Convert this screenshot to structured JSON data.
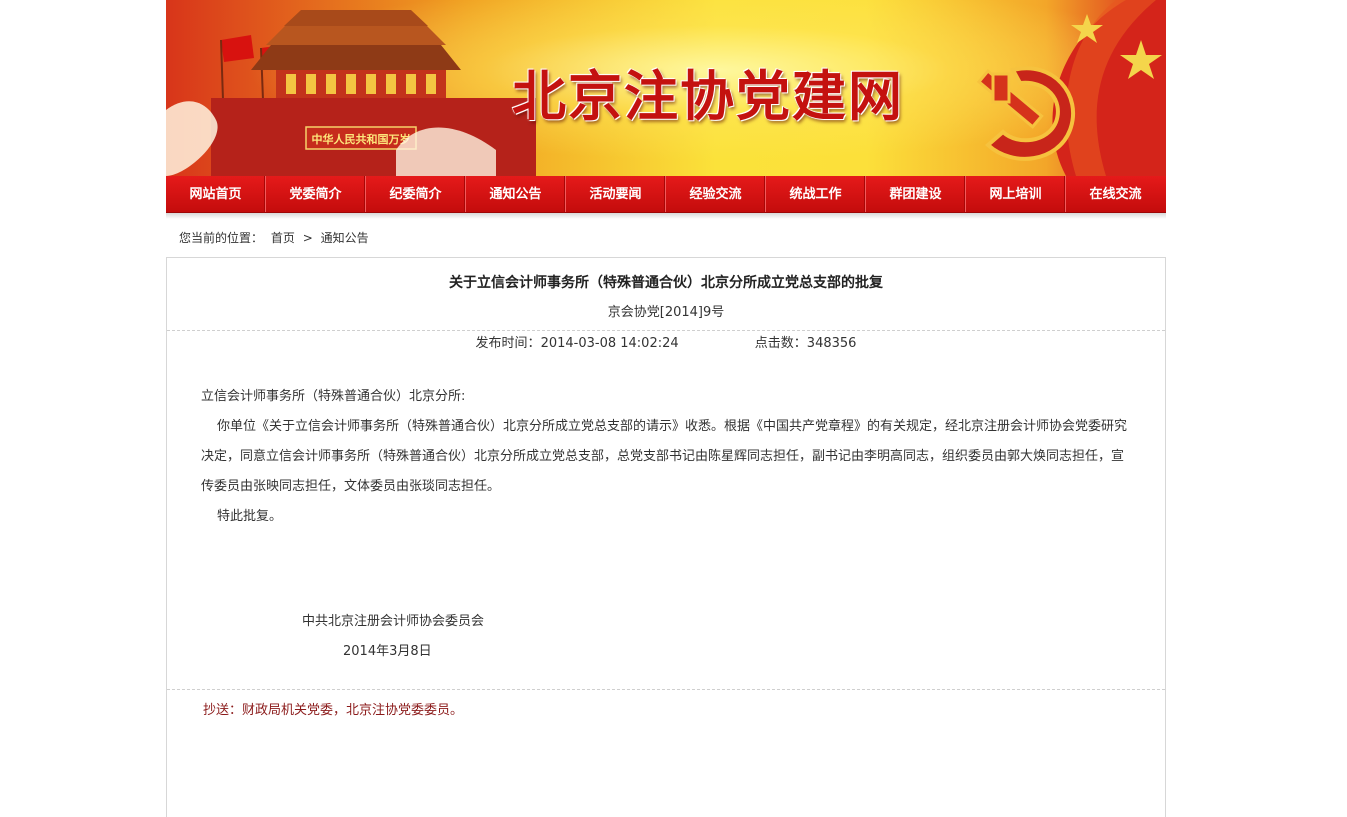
{
  "header": {
    "site_title": "北京注协党建网"
  },
  "nav": {
    "items": [
      "网站首页",
      "党委简介",
      "纪委简介",
      "通知公告",
      "活动要闻",
      "经验交流",
      "统战工作",
      "群团建设",
      "网上培训",
      "在线交流"
    ]
  },
  "breadcrumb": {
    "prefix": "您当前的位置：",
    "home": "首页",
    "separator": ">",
    "current": "通知公告"
  },
  "article": {
    "title": "关于立信会计师事务所（特殊普通合伙）北京分所成立党总支部的批复",
    "doc_number": "京会协党[2014]9号",
    "publish_label": "发布时间：",
    "publish_time": "2014-03-08 14:02:24",
    "hits_label": "点击数：",
    "hits": "348356",
    "salutation": "立信会计师事务所（特殊普通合伙）北京分所:",
    "paragraph": "你单位《关于立信会计师事务所（特殊普通合伙）北京分所成立党总支部的请示》收悉。根据《中国共产党章程》的有关规定，经北京注册会计师协会党委研究决定，同意立信会计师事务所（特殊普通合伙）北京分所成立党总支部，总党支部书记由陈星辉同志担任，副书记由李明高同志，组织委员由郭大焕同志担任，宣传委员由张映同志担任，文体委员由张琰同志担任。",
    "closing": "特此批复。",
    "signature_org": "中共北京注册会计师协会委员会",
    "signature_date": "2014年3月8日",
    "cc": "抄送：财政局机关党委，北京注协党委委员。"
  },
  "colors": {
    "nav_red": "#d81111",
    "title_red": "#c4120f",
    "cc_text": "#8b1a1a"
  }
}
